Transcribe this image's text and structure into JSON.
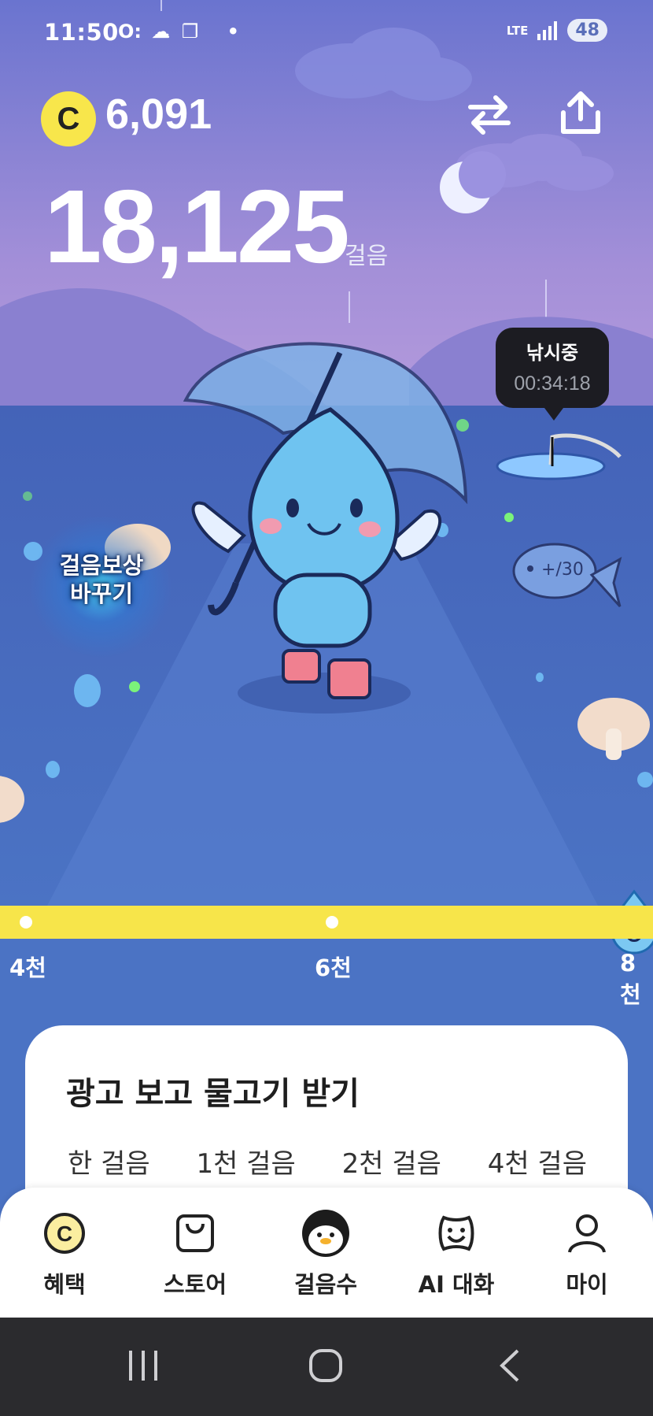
{
  "status_bar": {
    "time": "11:50",
    "left_icons": "O:",
    "network": "LTE",
    "battery": "48"
  },
  "header": {
    "coin_symbol": "C",
    "coin_balance": "6,091",
    "swap_icon": "swap-icon",
    "share_icon": "share-icon"
  },
  "steps": {
    "count": "18,125",
    "unit": "걸음"
  },
  "fishing": {
    "label": "낚시중",
    "timer": "00:34:18"
  },
  "reward_change": {
    "line1": "걸음보상",
    "line2": "바꾸기"
  },
  "progress": {
    "milestones": [
      "4천",
      "6천",
      "8천"
    ],
    "accent": "#f7e54a"
  },
  "ad_card": {
    "title": "광고 보고 물고기 받기",
    "tabs": [
      "한 걸음",
      "1천 걸음",
      "2천 걸음",
      "4천 걸음"
    ]
  },
  "bottom_nav": {
    "items": [
      {
        "label": "혜택",
        "icon": "coin-icon"
      },
      {
        "label": "스토어",
        "icon": "shopping-bag-icon"
      },
      {
        "label": "걸음수",
        "icon": "penguin-icon"
      },
      {
        "label": "AI 대화",
        "icon": "smile-face-icon"
      },
      {
        "label": "마이",
        "icon": "person-icon"
      }
    ]
  },
  "colors": {
    "sky_top": "#6a74cf",
    "sky_bottom": "#b495db",
    "ground": "#4b73c4",
    "progress": "#f7e54a",
    "coin": "#f8e64b"
  }
}
